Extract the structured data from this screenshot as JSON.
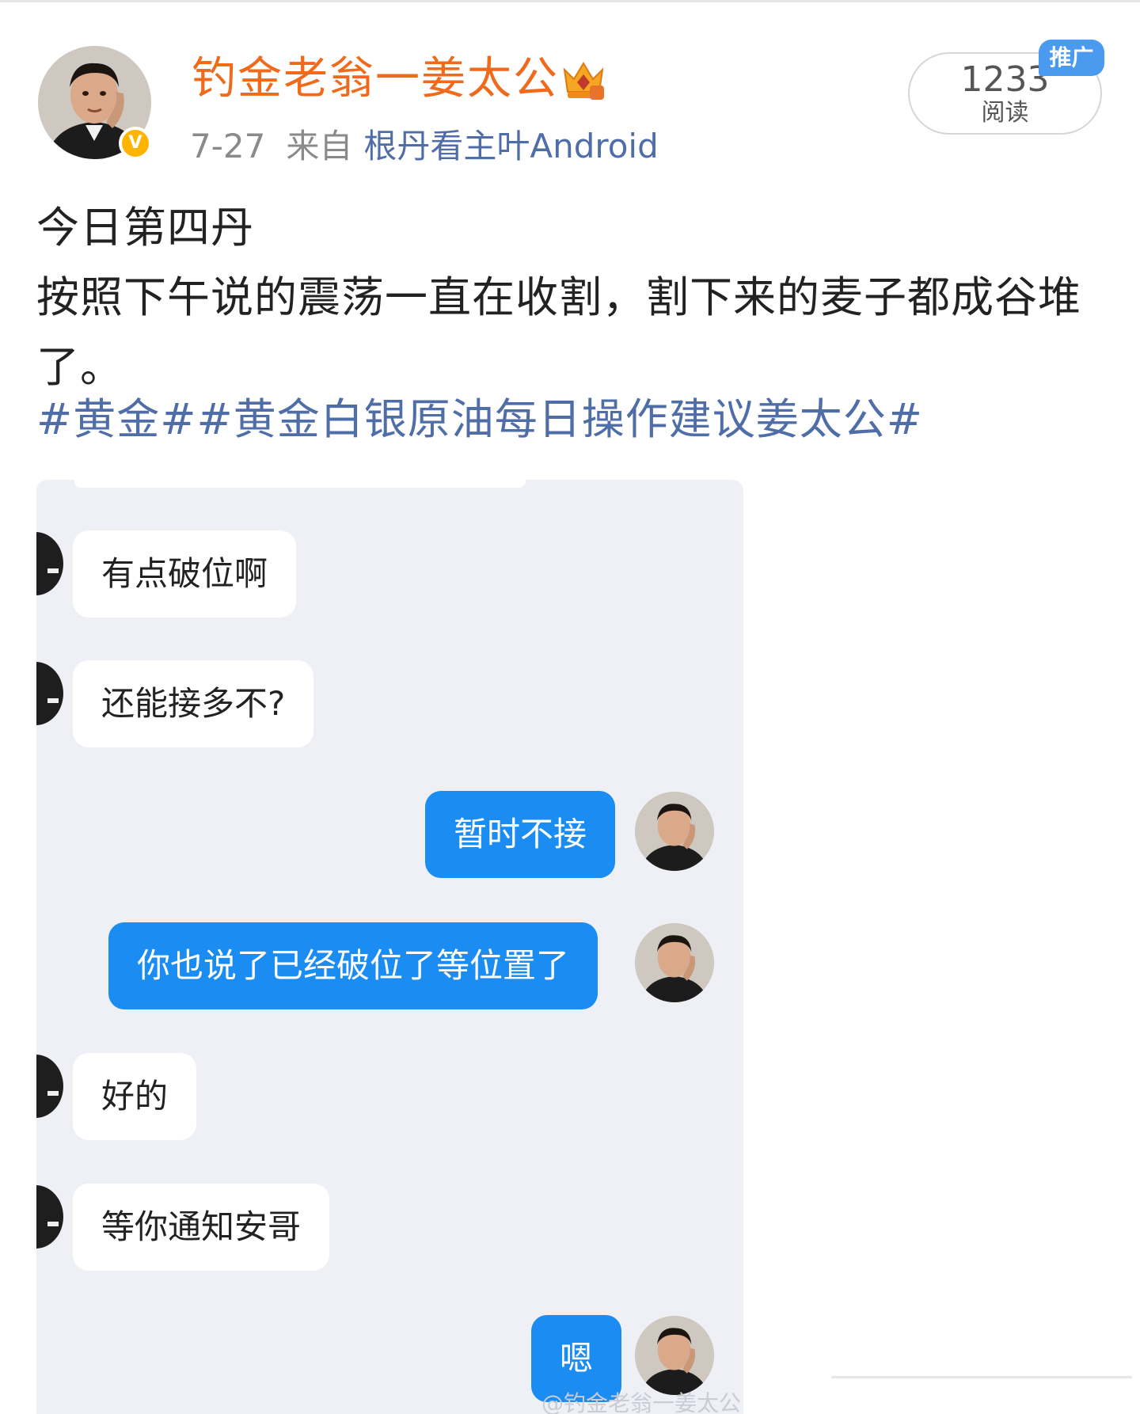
{
  "post": {
    "username": "钓金老翁一姜太公",
    "date": "7-27",
    "from_label": "来自",
    "source": "根丹看主叶Android",
    "read_count": "1233",
    "read_label": "阅读",
    "promo_badge": "推广",
    "verified_mark": "V",
    "text_lines": [
      "今日第四丹",
      "按照下午说的震荡一直在收割，割下来的麦子都成谷堆",
      "了。"
    ],
    "hashtags": "#黄金##黄金白银原油每日操作建议姜太公#"
  },
  "chat": {
    "messages": [
      {
        "side": "in",
        "text": "有点破位啊"
      },
      {
        "side": "in",
        "text": "还能接多不?"
      },
      {
        "side": "out",
        "text": "暂时不接"
      },
      {
        "side": "out",
        "text": "你也说了已经破位了等位置了"
      },
      {
        "side": "in",
        "text": "好的"
      },
      {
        "side": "in",
        "text": "等你通知安哥"
      },
      {
        "side": "out",
        "text": "嗯"
      }
    ],
    "watermark": "@钓金老翁一姜太公"
  },
  "colors": {
    "username": "#f06a1c",
    "link": "#4f6ea8",
    "bubble_out": "#1a8cf2",
    "chat_bg": "#eff0f6",
    "promo": "#4a9bf0",
    "verified": "#ffb400"
  },
  "icons": [
    "verified-badge-icon",
    "crown-level-icon"
  ]
}
